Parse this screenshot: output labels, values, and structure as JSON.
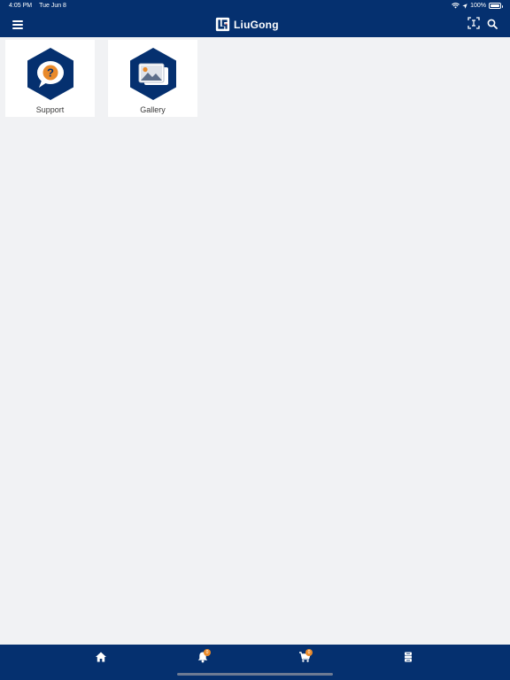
{
  "status_bar": {
    "time": "4:05 PM",
    "date": "Tue Jun 8",
    "battery": "100%",
    "icons": [
      "wifi-icon",
      "location-arrow-icon",
      "battery-icon"
    ]
  },
  "header": {
    "brand": "LiuGong",
    "menu_icon": "menu-icon",
    "scan_icon": "scan-icon",
    "search_icon": "search-icon"
  },
  "tiles": [
    {
      "label": "Support",
      "icon": "support-question-icon"
    },
    {
      "label": "Gallery",
      "icon": "gallery-image-icon"
    }
  ],
  "bottom_nav": {
    "items": [
      {
        "icon": "home-icon"
      },
      {
        "icon": "notification-bell-icon",
        "badge": "0"
      },
      {
        "icon": "cart-icon",
        "badge": "0"
      },
      {
        "icon": "machine-icon"
      }
    ]
  },
  "colors": {
    "primary": "#05306f",
    "accent": "#e98a2b",
    "background": "#f1f2f4",
    "tile": "#ffffff"
  }
}
